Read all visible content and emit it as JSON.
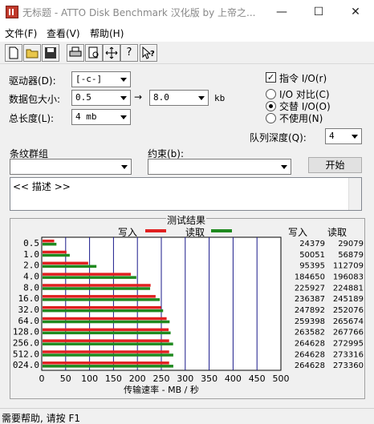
{
  "window": {
    "title": "无标题 - ATTO Disk Benchmark  汉化版 by 上帝之..."
  },
  "window_controls": {
    "minimize": "—",
    "maximize": "☐",
    "close": "✕"
  },
  "menu": [
    "文件(F)",
    "查看(V)",
    "帮助(H)"
  ],
  "toolbar": {
    "icons": [
      "new-file-icon",
      "open-folder-icon",
      "save-icon",
      "print-icon",
      "print-preview-icon",
      "move-icon",
      "help-icon",
      "context-help-icon"
    ],
    "help_glyph": "?"
  },
  "form": {
    "drive_label": "驱动器(D):",
    "drive_value": "[-c-]",
    "packet_label": "数据包大小:",
    "packet_from": "0.5",
    "arrow": "→",
    "packet_to": "8.0",
    "packet_unit": "kb",
    "total_label": "总长度(L):",
    "total_value": "4 mb",
    "direct_io_label": "指令 I/O(r)",
    "direct_io_checked": true,
    "io_compare_label": "I/O 对比(C)",
    "overlap_io_label": "交替 I/O(O)",
    "not_used_label": "不使用(N)",
    "queue_label": "队列深度(Q):",
    "queue_value": "4",
    "stripe_label": "条纹群组",
    "stripe_value": "",
    "constraint_label": "约束(b):",
    "constraint_value": "",
    "start_button": "开始",
    "description": "<< 描述 >>"
  },
  "results": {
    "group_title": "测试结果",
    "legend_write": "写入",
    "legend_read": "读取",
    "col_write": "写入",
    "col_read": "读取",
    "write_color": "#e02020",
    "read_color": "#1f8a1f",
    "xlabel": "传输速率 - MB / 秒",
    "write_values_text": [
      "24379",
      "50051",
      "95395",
      "184650",
      "225927",
      "236387",
      "247892",
      "259398",
      "263582",
      "264628",
      "264628",
      "264628"
    ],
    "read_values_text": [
      "29079",
      "56879",
      "112709",
      "196083",
      "224881",
      "245189",
      "252076",
      "265674",
      "267766",
      "272995",
      "273316",
      "273360"
    ]
  },
  "chart_data": {
    "type": "bar",
    "orientation": "horizontal",
    "categories": [
      "0.5",
      "1.0",
      "2.0",
      "4.0",
      "8.0",
      "16.0",
      "32.0",
      "64.0",
      "128.0",
      "256.0",
      "512.0",
      "1024.0"
    ],
    "category_tick_labels": [
      "0.5",
      "1.0",
      "2.0",
      "4.0",
      "8.0",
      "16.0",
      "32.0",
      "64.0",
      "128.0",
      "256.0",
      "512.0",
      "024.0"
    ],
    "series": [
      {
        "name": "写入",
        "values": [
          24.379,
          50.051,
          95.395,
          184.65,
          225.927,
          236.387,
          247.892,
          259.398,
          263.582,
          264.628,
          264.628,
          264.628
        ]
      },
      {
        "name": "读取",
        "values": [
          29.079,
          56.879,
          112.709,
          196.083,
          224.881,
          245.189,
          252.076,
          265.674,
          267.766,
          272.995,
          273.316,
          273.36
        ]
      }
    ],
    "xlabel": "传输速率 - MB / 秒",
    "xlim": [
      0,
      500
    ],
    "xticks": [
      0,
      50,
      100,
      150,
      200,
      250,
      300,
      350,
      400,
      450,
      500
    ],
    "grid": true
  },
  "status": {
    "text": "需要帮助, 请按 F1"
  }
}
